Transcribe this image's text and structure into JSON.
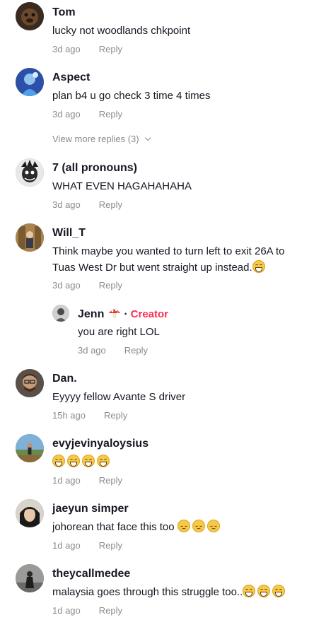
{
  "comments": [
    {
      "author": "Tom",
      "text": "lucky not woodlands chkpoint",
      "time": "3d ago",
      "reply": "Reply"
    },
    {
      "author": "Aspect",
      "text": "plan b4 u go check 3 time 4 times",
      "time": "3d ago",
      "reply": "Reply",
      "view_more": "View more replies (3)"
    },
    {
      "author": "7 (all pronouns)",
      "text": "WHAT EVEN HAGAHAHAHA",
      "time": "3d ago",
      "reply": "Reply"
    },
    {
      "author": "Will_T",
      "text": "Think maybe you wanted to turn left to exit 26A to Tuas West Dr but went straight up instead.",
      "time": "3d ago",
      "reply": "Reply",
      "reply_thread": {
        "author": "Jenn",
        "badge_separator": "·",
        "badge": "Creator",
        "text": "you are right LOL",
        "time": "3d ago",
        "reply": "Reply"
      }
    },
    {
      "author": "Dan.",
      "text": "Eyyyy fellow Avante S driver",
      "time": "15h ago",
      "reply": "Reply"
    },
    {
      "author": "evyjevinyaloysius",
      "text": "",
      "time": "1d ago",
      "reply": "Reply"
    },
    {
      "author": "jaeyun simper",
      "text": "johorean that face this too",
      "time": "1d ago",
      "reply": "Reply"
    },
    {
      "author": "theycallmedee",
      "text": "malaysia goes through this struggle too..",
      "time": "1d ago",
      "reply": "Reply"
    }
  ],
  "colors": {
    "creator": "#fe2c55",
    "meta": "#8a8b91",
    "text": "#161823"
  }
}
